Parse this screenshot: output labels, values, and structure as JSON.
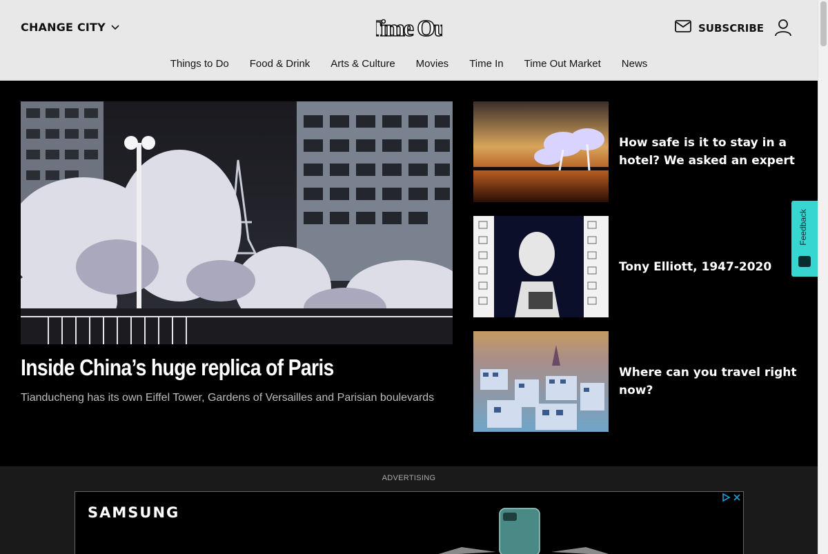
{
  "header": {
    "change_city": "CHANGE CITY",
    "logo_text": "Time Out",
    "subscribe": "SUBSCRIBE"
  },
  "nav": {
    "items": [
      {
        "label": "Things to Do"
      },
      {
        "label": "Food & Drink"
      },
      {
        "label": "Arts & Culture"
      },
      {
        "label": "Movies"
      },
      {
        "label": "Time In"
      },
      {
        "label": "Time Out Market"
      },
      {
        "label": "News"
      }
    ]
  },
  "hero": {
    "title": "Inside China’s huge replica of Paris",
    "subtitle": "Tianducheng has its own Eiffel Tower, Gardens of Versailles and Parisian boulevards"
  },
  "stories": [
    {
      "title": "How safe is it to stay in a hotel? We asked an expert"
    },
    {
      "title": "Tony Elliott, 1947-2020"
    },
    {
      "title": "Where can you travel right now?"
    }
  ],
  "feedback": {
    "label": "Feedback"
  },
  "ad": {
    "label": "ADVERTISING",
    "brand": "SAMSUNG"
  },
  "colors": {
    "header_bg": "#e8e8e8",
    "page_bg": "#000000",
    "feedback_bg": "#38d6d0"
  }
}
